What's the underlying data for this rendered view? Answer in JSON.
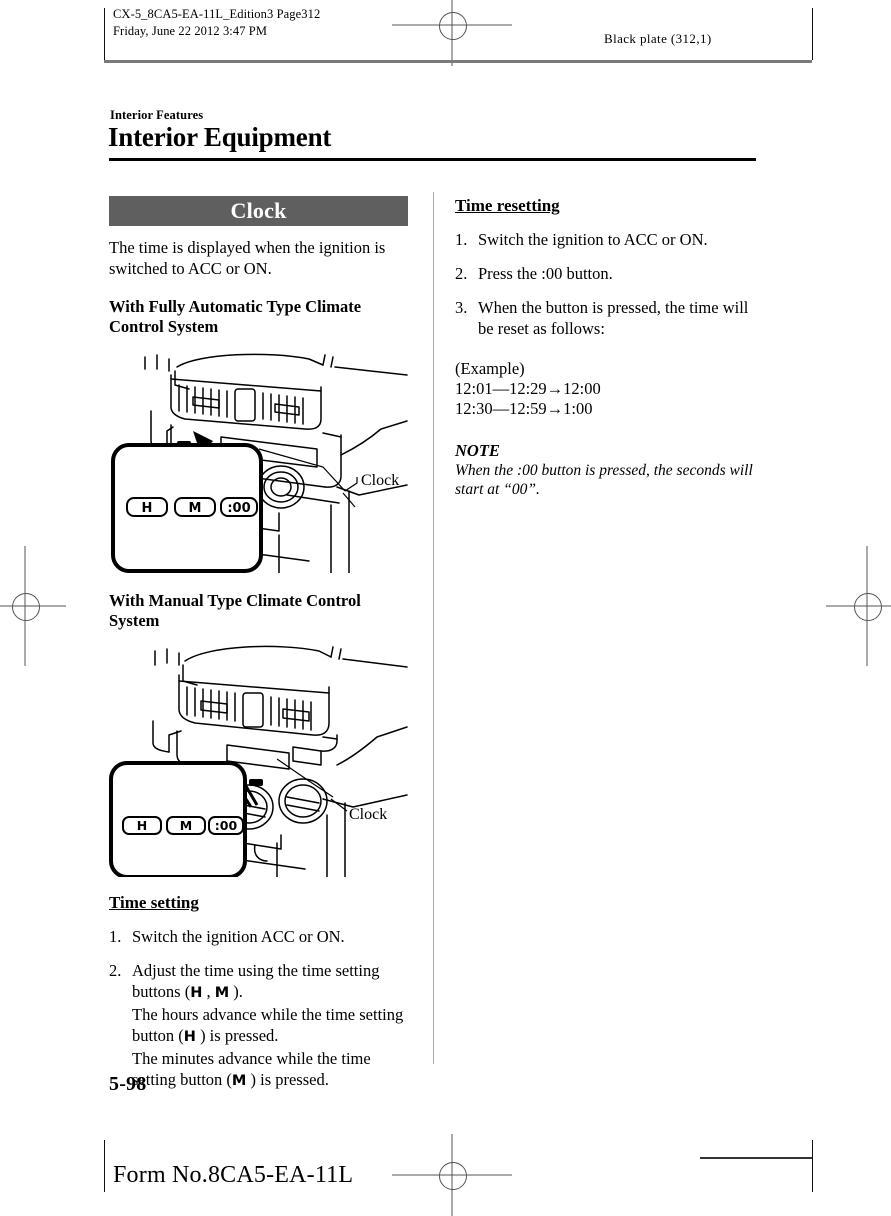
{
  "header": {
    "left_meta": "CX-5_8CA5-EA-11L_Edition3 Page312\nFriday, June 22 2012 3:47 PM",
    "right_meta": "Black plate (312,1)"
  },
  "page": {
    "kicker": "Interior Features",
    "chapter_title": "Interior Equipment",
    "folio": "5-98",
    "form_number": "Form No.8CA5-EA-11L"
  },
  "left_column": {
    "section_bar": "Clock",
    "intro": "The time is displayed when the ignition is switched to ACC or ON.",
    "fig1_heading": "With Fully Automatic Type Climate Control System",
    "fig1_callout": "Clock",
    "fig1_buttons": [
      "H",
      "M",
      ":00"
    ],
    "fig2_heading": "With Manual Type Climate Control System",
    "fig2_callout": "Clock",
    "fig2_buttons": [
      "H",
      "M",
      ":00"
    ],
    "time_setting_heading": "Time setting",
    "steps": [
      {
        "num": "1.",
        "text": "Switch the ignition ACC or ON."
      },
      {
        "num": "2.",
        "text": "Adjust the time using the time setting buttons ("
      }
    ],
    "step2_tail": " , ",
    "step2_close": " ).",
    "step2_btn_a": "H",
    "step2_btn_b": "M",
    "step2_line2_a": "The hours advance while the time setting button (",
    "step2_line2_btn": "H",
    "step2_line2_b": " ) is pressed.",
    "step2_line3_a": "The minutes advance while the time setting button (",
    "step2_line3_btn": "M",
    "step2_line3_b": " ) is pressed."
  },
  "right_column": {
    "time_resetting_heading": "Time resetting",
    "steps": [
      {
        "num": "1.",
        "text": "Switch the ignition to ACC or ON."
      },
      {
        "num": "2.",
        "text": "Press the :00 button."
      },
      {
        "num": "3.",
        "text": "When the button is pressed, the time will be reset as follows:"
      }
    ],
    "example": "(Example)\n12:01—12:29→12:00\n12:30—12:59→1:00",
    "note_title": "NOTE",
    "note_body": "When the :00 button is pressed, the seconds will start at “00”."
  },
  "colors": {
    "section_bar_bg": "#5f5f5f",
    "rule": "#000000",
    "divider": "#aaaaaa"
  }
}
